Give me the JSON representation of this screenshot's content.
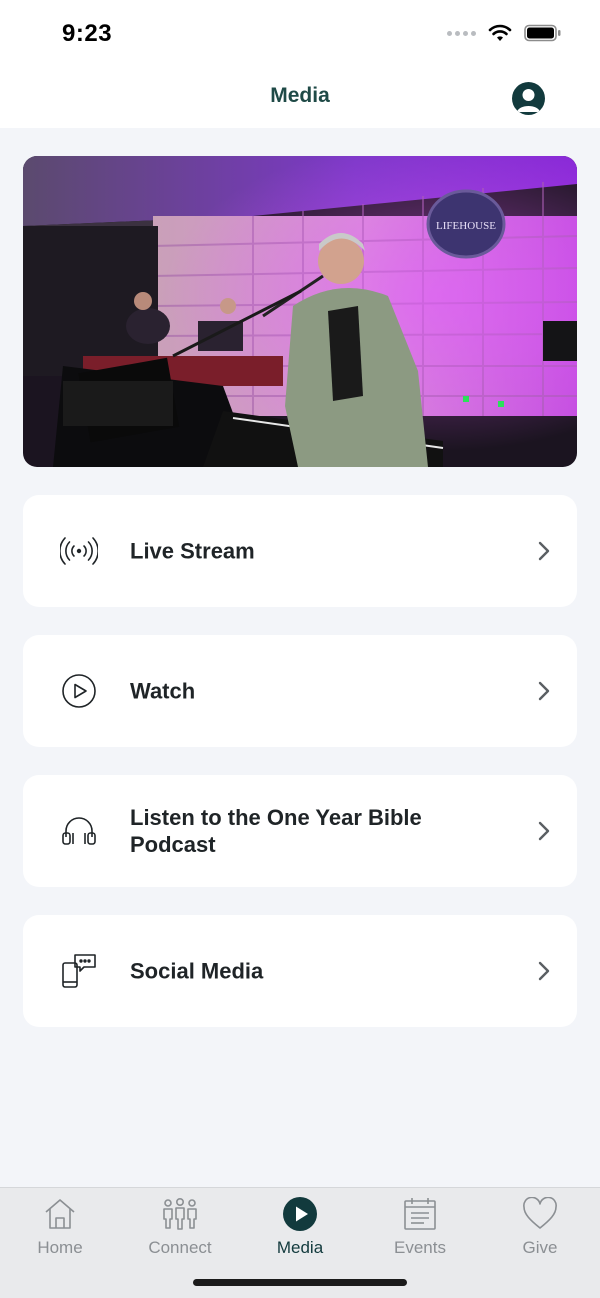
{
  "status_bar": {
    "time": "9:23"
  },
  "header": {
    "title": "Media"
  },
  "hero": {
    "stage_sign": "LIFEHOUSE"
  },
  "menu": [
    {
      "label": "Live Stream",
      "icon": "broadcast-icon"
    },
    {
      "label": "Watch",
      "icon": "play-circle-icon"
    },
    {
      "label": "Listen to the One Year Bible Podcast",
      "icon": "headphones-icon"
    },
    {
      "label": "Social Media",
      "icon": "social-phone-chat-icon"
    }
  ],
  "tabs": [
    {
      "label": "Home",
      "icon": "house-icon",
      "active": false
    },
    {
      "label": "Connect",
      "icon": "people-group-icon",
      "active": false
    },
    {
      "label": "Media",
      "icon": "play-button-icon",
      "active": true
    },
    {
      "label": "Events",
      "icon": "calendar-list-icon",
      "active": false
    },
    {
      "label": "Give",
      "icon": "heart-icon",
      "active": false
    }
  ],
  "colors": {
    "accent": "#123a3d",
    "title": "#1f4a47",
    "inactive": "#8b8f93",
    "background": "#f3f5f9"
  }
}
